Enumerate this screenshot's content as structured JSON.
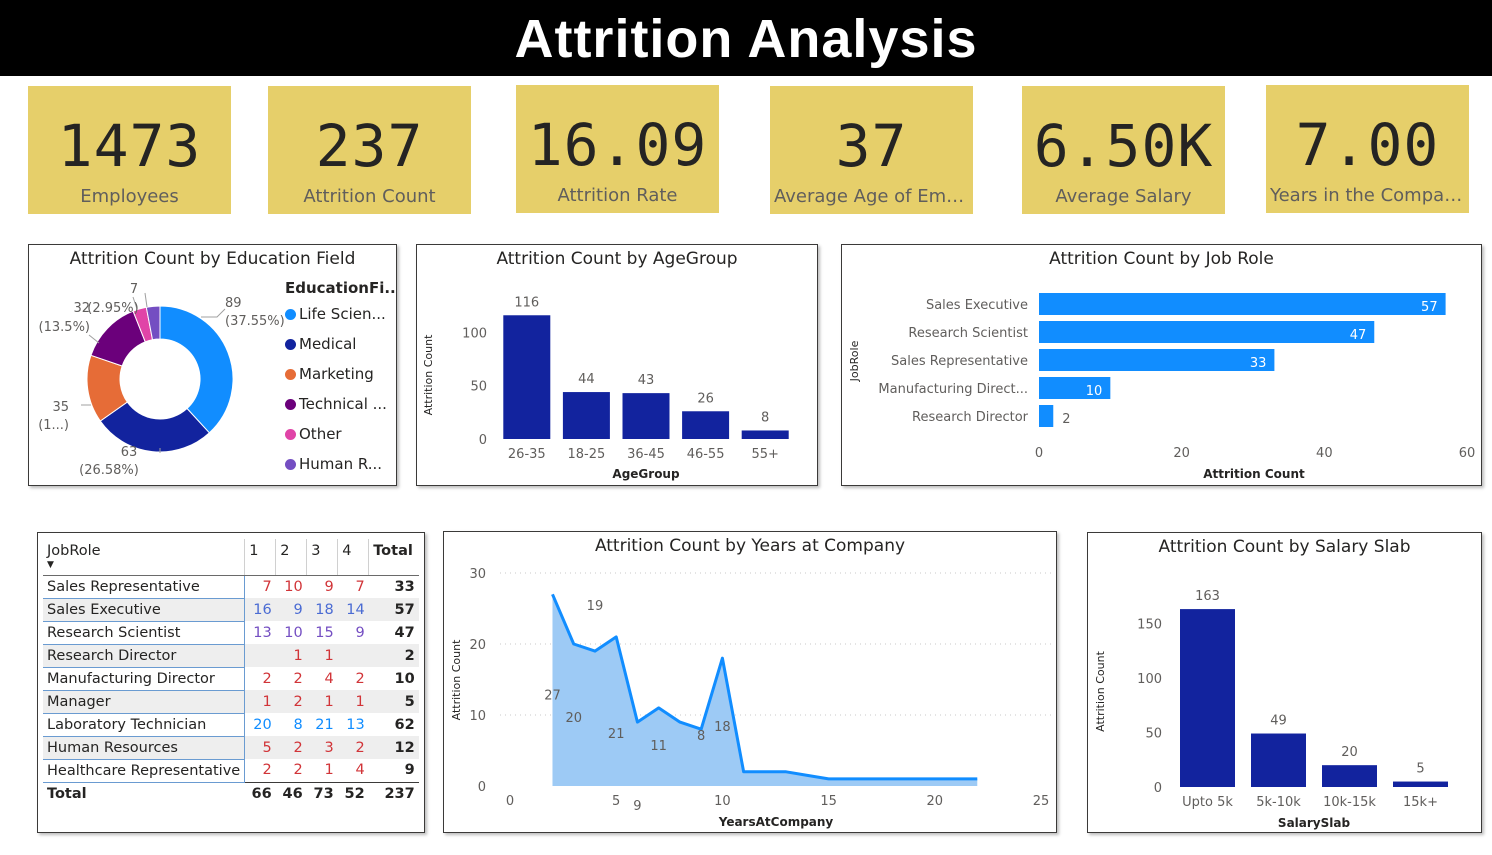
{
  "header": {
    "title": "Attrition Analysis"
  },
  "colors": {
    "card": "#e6cf6a",
    "bar_dark": "#12239e",
    "bar_light": "#118dff",
    "area": "#118dff",
    "header_bg": "#000000"
  },
  "cards": [
    {
      "value": "1473",
      "label": "Employees"
    },
    {
      "value": "237",
      "label": "Attrition Count"
    },
    {
      "value": "16.09",
      "label": "Attrition Rate"
    },
    {
      "value": "37",
      "label": "Average Age of Empl..."
    },
    {
      "value": "6.50K",
      "label": "Average Salary"
    },
    {
      "value": "7.00",
      "label": "Years in the Company"
    }
  ],
  "education_chart": {
    "title": "Attrition Count by Education Field",
    "legend_title": "EducationFi...",
    "legend": [
      {
        "label": "Life Scien...",
        "color": "#118dff"
      },
      {
        "label": "Medical",
        "color": "#12239e"
      },
      {
        "label": "Marketing",
        "color": "#e66c37"
      },
      {
        "label": "Technical ...",
        "color": "#6b007b"
      },
      {
        "label": "Other",
        "color": "#e044a7"
      },
      {
        "label": "Human R...",
        "color": "#744ec2"
      }
    ]
  },
  "matrix": {
    "row_header": "JobRole",
    "columns": [
      "1",
      "2",
      "3",
      "4"
    ],
    "total_label": "Total",
    "rows": [
      {
        "role": "Sales Representative",
        "vals": [
          "7",
          "10",
          "9",
          "7"
        ],
        "total": "33",
        "color": "#d13438"
      },
      {
        "role": "Sales Executive",
        "vals": [
          "16",
          "9",
          "18",
          "14"
        ],
        "total": "57",
        "color": "#4a6bd3"
      },
      {
        "role": "Research Scientist",
        "vals": [
          "13",
          "10",
          "15",
          "9"
        ],
        "total": "47",
        "color": "#744ec2"
      },
      {
        "role": "Research Director",
        "vals": [
          "",
          "1",
          "1",
          ""
        ],
        "total": "2",
        "color": "#d13438"
      },
      {
        "role": "Manufacturing Director",
        "vals": [
          "2",
          "2",
          "4",
          "2"
        ],
        "total": "10",
        "color": "#d13438"
      },
      {
        "role": "Manager",
        "vals": [
          "1",
          "2",
          "1",
          "1"
        ],
        "total": "5",
        "color": "#d13438"
      },
      {
        "role": "Laboratory Technician",
        "vals": [
          "20",
          "8",
          "21",
          "13"
        ],
        "total": "62",
        "color": "#118dff"
      },
      {
        "role": "Human Resources",
        "vals": [
          "5",
          "2",
          "3",
          "2"
        ],
        "total": "12",
        "color": "#d13438"
      },
      {
        "role": "Healthcare Representative",
        "vals": [
          "2",
          "2",
          "1",
          "4"
        ],
        "total": "9",
        "color": "#d13438"
      }
    ],
    "totals": {
      "label": "Total",
      "vals": [
        "66",
        "46",
        "73",
        "52"
      ],
      "total": "237"
    }
  },
  "chart_data": [
    {
      "type": "pie",
      "title": "Attrition Count by Education Field",
      "categories": [
        "Life Scien...",
        "Medical",
        "Marketing",
        "Technical ...",
        "Other",
        "Human R..."
      ],
      "values": [
        89,
        63,
        35,
        32,
        7,
        7
      ],
      "labels": [
        "89",
        "(37.55%)",
        "63",
        "(26.58%)",
        "35",
        "(1...)",
        "32",
        "(13.5%)",
        "7",
        "(2.95%)"
      ]
    },
    {
      "type": "bar",
      "title": "Attrition Count by AgeGroup",
      "categories": [
        "26-35",
        "18-25",
        "36-45",
        "46-55",
        "55+"
      ],
      "values": [
        116,
        44,
        43,
        26,
        8
      ],
      "xlabel": "AgeGroup",
      "ylabel": "Attrition Count",
      "ylim": [
        0,
        120
      ],
      "yticks": [
        "0",
        "50",
        "100"
      ]
    },
    {
      "type": "bar",
      "orientation": "horizontal",
      "title": "Attrition Count by Job Role",
      "categories": [
        "Sales Executive",
        "Research Scientist",
        "Sales Representative",
        "Manufacturing Direct...",
        "Research Director"
      ],
      "values": [
        57,
        47,
        33,
        10,
        2
      ],
      "xlabel": "Attrition Count",
      "ylabel": "JobRole",
      "xlim": [
        0,
        60
      ],
      "xticks": [
        "0",
        "20",
        "40",
        "60"
      ]
    },
    {
      "type": "area",
      "title": "Attrition Count by Years at Company",
      "x": [
        2,
        3,
        4,
        5,
        6,
        7,
        8,
        9,
        10,
        11,
        12,
        13,
        14,
        15,
        16,
        17,
        18,
        19,
        20,
        21,
        22
      ],
      "values": [
        27,
        20,
        19,
        21,
        9,
        11,
        9,
        8,
        18,
        2,
        2,
        2,
        1.5,
        1,
        1,
        1,
        1,
        1,
        1,
        1,
        1
      ],
      "point_labels": [
        {
          "x": 2,
          "y": 27,
          "text": "27"
        },
        {
          "x": 3,
          "y": 20,
          "text": "20"
        },
        {
          "x": 4,
          "y": 19,
          "text": "19"
        },
        {
          "x": 5,
          "y": 21,
          "text": "21"
        },
        {
          "x": 6,
          "y": 9,
          "text": "9"
        },
        {
          "x": 7,
          "y": 11,
          "text": "11"
        },
        {
          "x": 9,
          "y": 8,
          "text": "8"
        },
        {
          "x": 10,
          "y": 18,
          "text": "18"
        }
      ],
      "xlabel": "YearsAtCompany",
      "ylabel": "Attrition Count",
      "xlim": [
        0,
        25
      ],
      "ylim": [
        0,
        30
      ],
      "xticks": [
        "0",
        "5",
        "10",
        "15",
        "20",
        "25"
      ],
      "yticks": [
        "0",
        "10",
        "20",
        "30"
      ],
      "grid": true
    },
    {
      "type": "bar",
      "title": "Attrition Count by Salary Slab",
      "categories": [
        "Upto 5k",
        "5k-10k",
        "10k-15k",
        "15k+"
      ],
      "values": [
        163,
        49,
        20,
        5
      ],
      "xlabel": "SalarySlab",
      "ylabel": "Attrition Count",
      "ylim": [
        0,
        175
      ],
      "yticks": [
        "0",
        "50",
        "100",
        "150"
      ]
    }
  ]
}
